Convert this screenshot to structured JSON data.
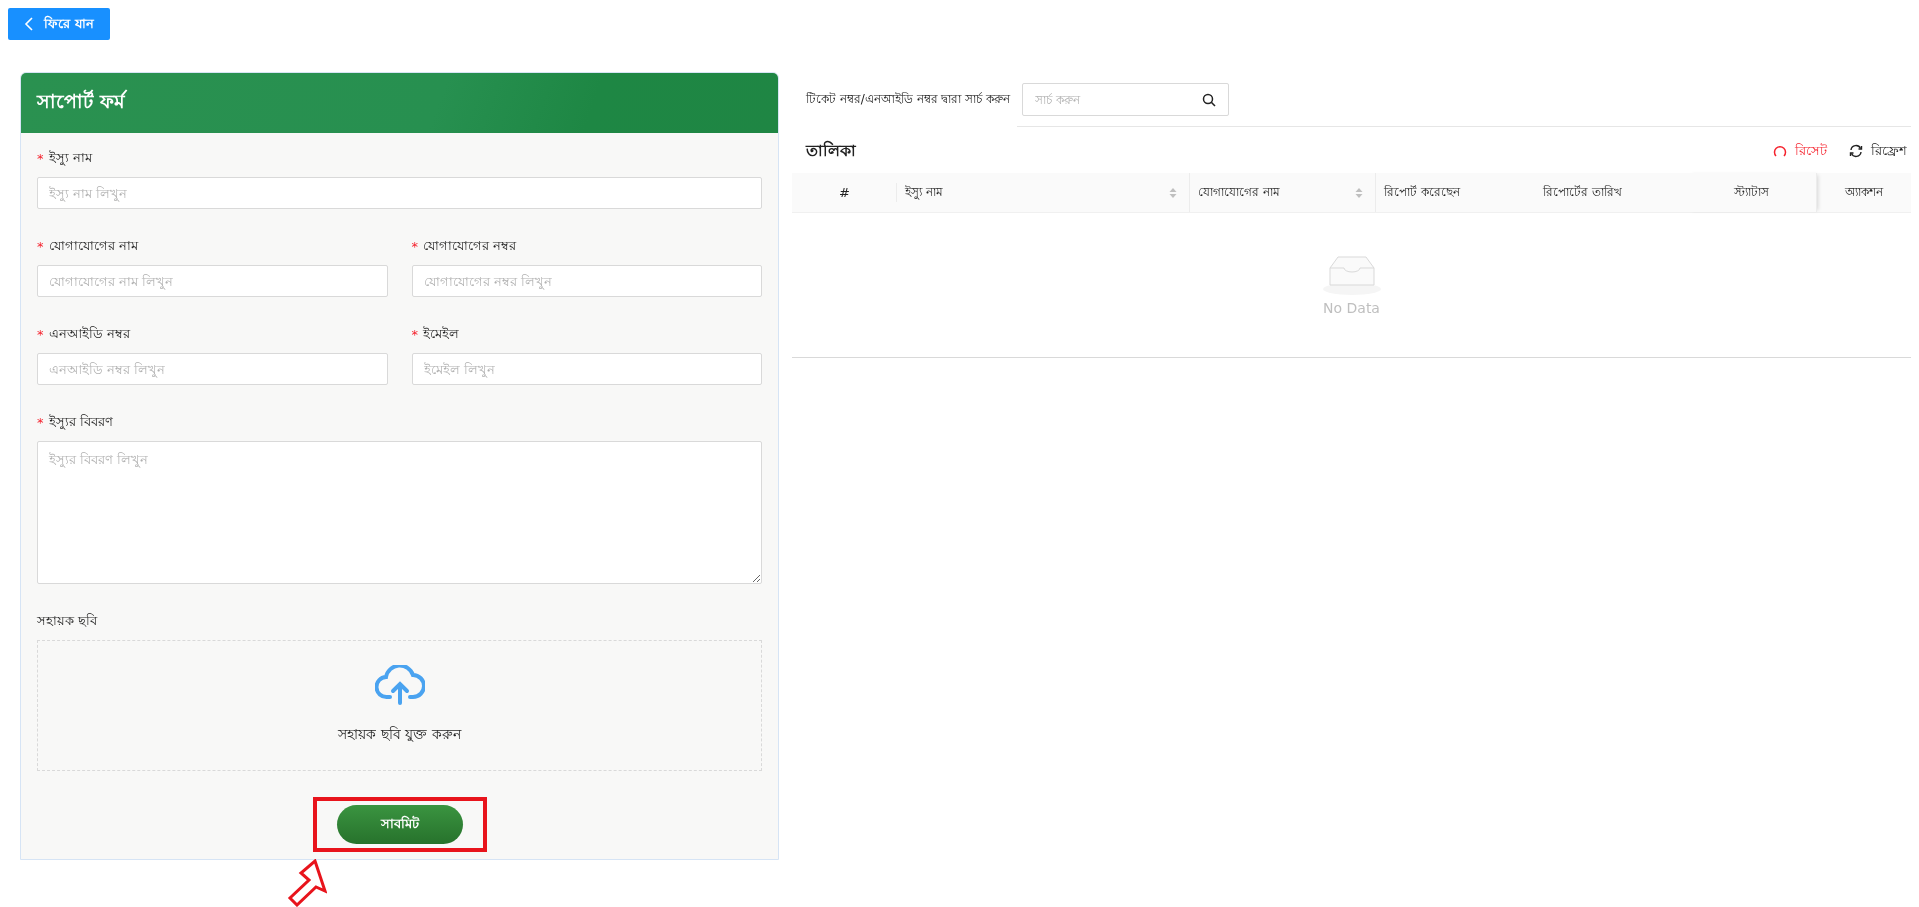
{
  "back_button": {
    "label": "ফিরে যান"
  },
  "form": {
    "title": "সাপোর্ট ফর্ম",
    "rows": [
      [
        {
          "kind": "input",
          "required_mark": "*",
          "label": "ইস্যু নাম",
          "placeholder": "ইস্যু নাম লিখুন"
        }
      ],
      [
        {
          "kind": "input",
          "required_mark": "*",
          "label": "যোগাযোগের নাম",
          "placeholder": "যোগাযোগের নাম লিখুন"
        },
        {
          "kind": "input",
          "required_mark": "*",
          "label": "যোগাযোগের নম্বর",
          "placeholder": "যোগাযোগের নম্বর লিখুন"
        }
      ],
      [
        {
          "kind": "input",
          "required_mark": "*",
          "label": "এনআইডি নম্বর",
          "placeholder": "এনআইডি নম্বর লিখুন"
        },
        {
          "kind": "input",
          "required_mark": "*",
          "label": "ইমেইল",
          "placeholder": "ইমেইল লিখুন"
        }
      ],
      [
        {
          "kind": "textarea",
          "required_mark": "*",
          "label": "ইস্যুর বিবরণ",
          "placeholder": "ইস্যুর বিবরণ লিখুন"
        }
      ],
      [
        {
          "kind": "upload",
          "label": "সহায়ক ছবি",
          "text": "সহায়ক ছবি যুক্ত করুন"
        }
      ]
    ],
    "submit_button": {
      "label": "সাবমিট",
      "highlighted": true
    }
  },
  "search": {
    "label": "টিকেট নম্বর/এনআইডি নম্বর দ্বারা সার্চ করুন",
    "placeholder": "সার্চ করুন"
  },
  "table": {
    "title": "তালিকা",
    "actions": [
      {
        "kind": "reset",
        "label": "রিসেট"
      },
      {
        "kind": "refresh",
        "label": "রিফ্রেশ"
      }
    ],
    "columns": [
      {
        "label": "#",
        "sortable": false
      },
      {
        "label": "ইস্যু নাম",
        "sortable": true
      },
      {
        "label": "যোগাযোগের নাম",
        "sortable": true
      },
      {
        "label": "রিপোর্ট করেছেন",
        "sortable": false
      },
      {
        "label": "রিপোর্টের তারিখ",
        "sortable": false
      },
      {
        "label": "স্ট্যাটাস",
        "sortable": false
      },
      {
        "label": "অ্যাকশন",
        "sortable": false
      }
    ],
    "empty_text": "No Data"
  }
}
